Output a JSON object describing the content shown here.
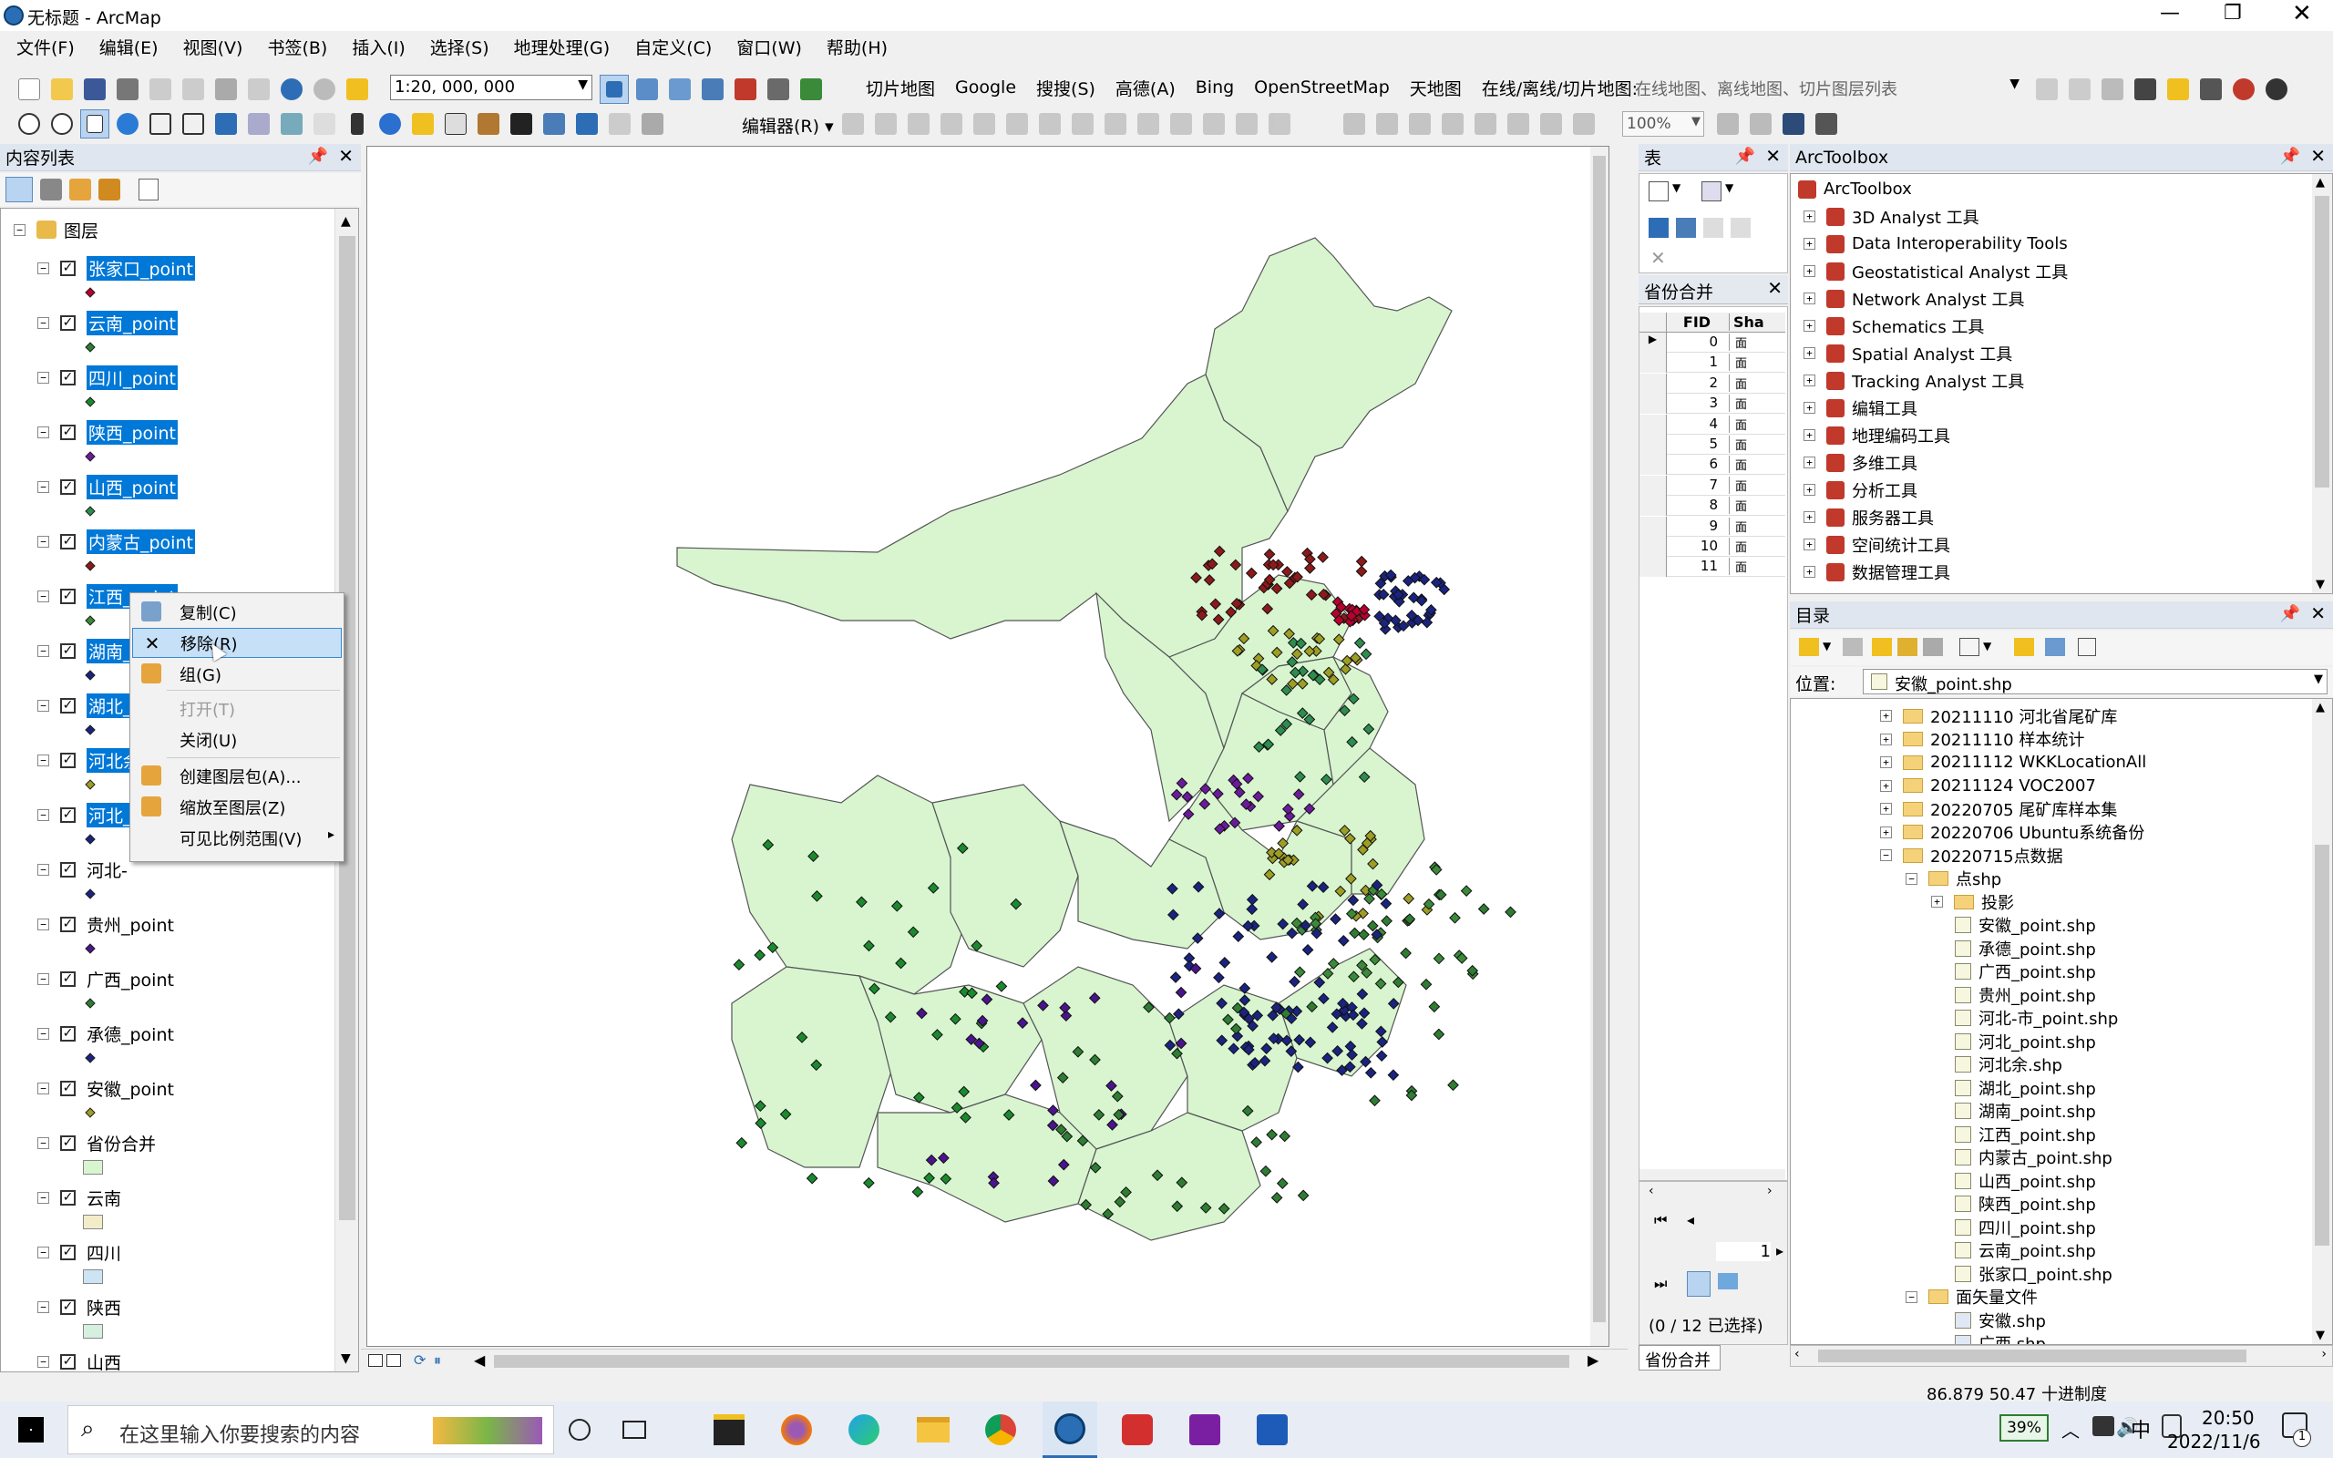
{
  "window": {
    "title": "无标题 - ArcMap"
  },
  "menu": [
    "文件(F)",
    "编辑(E)",
    "视图(V)",
    "书签(B)",
    "插入(I)",
    "选择(S)",
    "地理处理(G)",
    "自定义(C)",
    "窗口(W)",
    "帮助(H)"
  ],
  "toolbar1": {
    "scale": "1:20, 000, 000",
    "tile_map": "切片地图",
    "google": "Google",
    "sougou": "搜搜(S)",
    "gaode": "高德(A)",
    "bing": "Bing",
    "osm": "OpenStreetMap",
    "tianditu": "天地图",
    "online_label": "在线/离线/切片地图:",
    "online_placeholder": "在线地图、离线地图、切片图层列表"
  },
  "toolbar2": {
    "editor": "编辑器(R)",
    "zoom": "100%"
  },
  "toc": {
    "title": "内容列表",
    "root": "图层",
    "layers": [
      {
        "name": "张家口_point",
        "selected": true,
        "color": "#b8002f"
      },
      {
        "name": "云南_point",
        "selected": true,
        "color": "#2e7d32"
      },
      {
        "name": "四川_point",
        "selected": true,
        "color": "#1b8a2e"
      },
      {
        "name": "陕西_point",
        "selected": true,
        "color": "#6a1b9a"
      },
      {
        "name": "山西_point",
        "selected": true,
        "color": "#2d8c4e"
      },
      {
        "name": "内蒙古_point",
        "selected": true,
        "color": "#8b1a1a"
      },
      {
        "name": "江西_point",
        "selected": true,
        "color": "#3a8a3a"
      },
      {
        "name": "湖南_",
        "selected": true,
        "color": "#1a237e"
      },
      {
        "name": "湖北_",
        "selected": true,
        "color": "#1a237e"
      },
      {
        "name": "河北余",
        "selected": true,
        "color": "#9e9d24"
      },
      {
        "name": "河北_",
        "selected": true,
        "color": "#1a237e"
      },
      {
        "name": "河北-",
        "selected": false,
        "color": "#1a237e"
      },
      {
        "name": "贵州_point",
        "selected": false,
        "color": "#4a148c"
      },
      {
        "name": "广西_point",
        "selected": false,
        "color": "#2e7d32"
      },
      {
        "name": "承德_point",
        "selected": false,
        "color": "#1a237e"
      },
      {
        "name": "安徽_point",
        "selected": false,
        "color": "#9e9d24"
      }
    ],
    "polygons": [
      {
        "name": "省份合并",
        "fill": "#d8f5d0"
      },
      {
        "name": "云南",
        "fill": "#f3ecc8"
      },
      {
        "name": "四川",
        "fill": "#cde4f5"
      },
      {
        "name": "陕西",
        "fill": "#d6f0e0"
      },
      {
        "name": "山西",
        "fill": "#cfe0f5"
      }
    ]
  },
  "context_menu": {
    "items": [
      {
        "label": "复制(C)",
        "icon": "copy-icon",
        "enabled": true
      },
      {
        "label": "移除(R)",
        "icon": "remove-icon",
        "enabled": true,
        "highlight": true
      },
      {
        "label": "组(G)",
        "icon": "group-icon",
        "enabled": true
      },
      {
        "label": "打开(T)",
        "icon": "",
        "enabled": false
      },
      {
        "label": "关闭(U)",
        "icon": "",
        "enabled": true
      },
      {
        "label": "创建图层包(A)...",
        "icon": "layer-package-icon",
        "enabled": true
      },
      {
        "label": "缩放至图层(Z)",
        "icon": "zoom-layer-icon",
        "enabled": true
      },
      {
        "label": "可见比例范围(V)",
        "icon": "",
        "enabled": true,
        "submenu": true
      }
    ]
  },
  "table": {
    "title": "表",
    "subtitle": "省份合并",
    "col_fid": "FID",
    "col_shape": "Sha",
    "rows": [
      "0",
      "1",
      "2",
      "3",
      "4",
      "5",
      "6",
      "7",
      "8",
      "9",
      "10",
      "11"
    ],
    "shape_value": "面",
    "page": "1",
    "status": "(0 / 12 已选择)",
    "tab": "省份合并"
  },
  "arctoolbox": {
    "title": "ArcToolbox",
    "root": "ArcToolbox",
    "items": [
      "3D Analyst 工具",
      "Data Interoperability Tools",
      "Geostatistical Analyst 工具",
      "Network Analyst 工具",
      "Schematics 工具",
      "Spatial Analyst 工具",
      "Tracking Analyst 工具",
      "编辑工具",
      "地理编码工具",
      "多维工具",
      "分析工具",
      "服务器工具",
      "空间统计工具",
      "数据管理工具"
    ]
  },
  "catalog": {
    "title": "目录",
    "location_label": "位置:",
    "location_value": "安徽_point.shp",
    "folders": [
      "20211110 河北省尾矿库",
      "20211110 样本统计",
      "20211112 WKKLocationAll",
      "20211124 VOC2007",
      "20220705 尾矿库样本集",
      "20220706 Ubuntu系统备份",
      "20220715点数据"
    ],
    "subfolder": "点shp",
    "projection": "投影",
    "files": [
      "安徽_point.shp",
      "承德_point.shp",
      "广西_point.shp",
      "贵州_point.shp",
      "河北-市_point.shp",
      "河北_point.shp",
      "河北余.shp",
      "湖北_point.shp",
      "湖南_point.shp",
      "江西_point.shp",
      "内蒙古_point.shp",
      "山西_point.shp",
      "陕西_point.shp",
      "四川_point.shp",
      "云南_point.shp",
      "张家口_point.shp"
    ],
    "face_folder": "面矢量文件",
    "face_files": [
      "安徽.shp",
      "广西.shp"
    ]
  },
  "status": {
    "coords": "86.879  50.47 十进制度"
  },
  "taskbar": {
    "search": "在这里输入你要搜索的内容",
    "battery": "39%",
    "ime": "中",
    "time": "20:50",
    "date": "2022/11/6",
    "notif": "1"
  }
}
